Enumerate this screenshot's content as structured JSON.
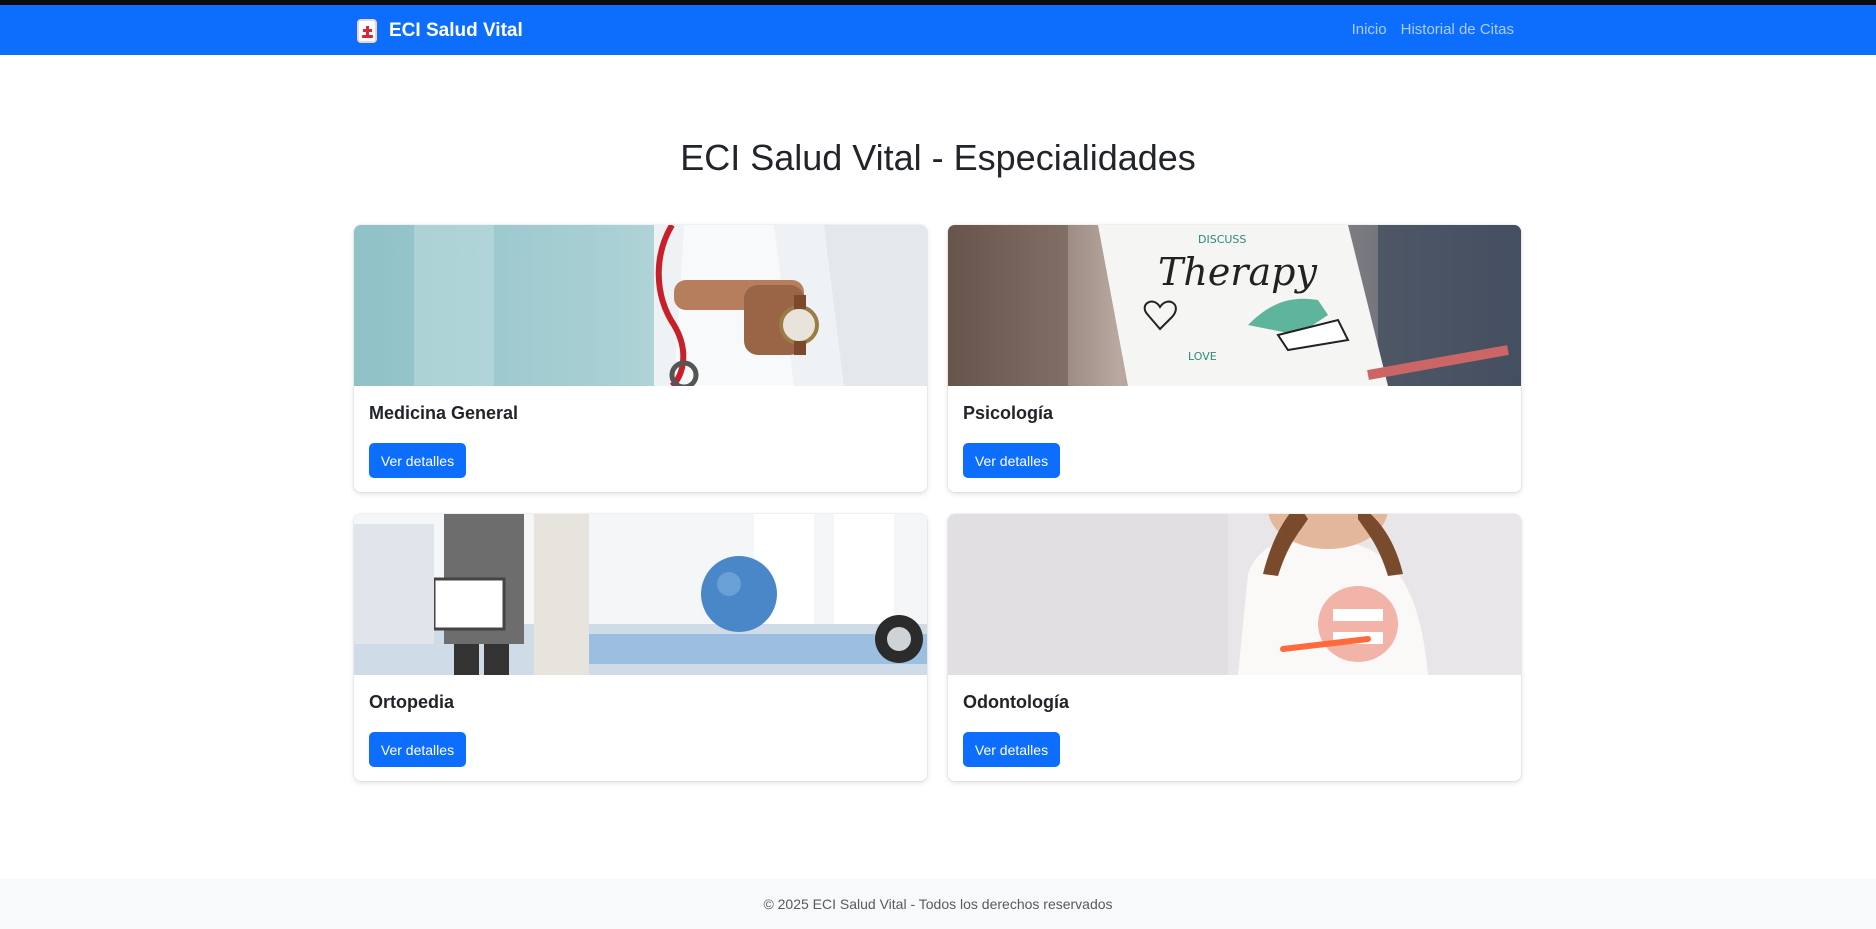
{
  "navbar": {
    "brand": "ECI Salud Vital",
    "links": [
      "Inicio",
      "Historial de Citas"
    ],
    "accent_color": "#0d6efd",
    "logo_icon": "medical-cross-icon"
  },
  "main": {
    "title": "ECI Salud Vital - Especialidades",
    "cards": [
      {
        "title": "Medicina General",
        "button": "Ver detalles",
        "image_icon": "doctor-photo"
      },
      {
        "title": "Psicología",
        "button": "Ver detalles",
        "image_icon": "therapy-photo"
      },
      {
        "title": "Ortopedia",
        "button": "Ver detalles",
        "image_icon": "physiotherapy-photo"
      },
      {
        "title": "Odontología",
        "button": "Ver detalles",
        "image_icon": "dental-photo"
      }
    ]
  },
  "footer": {
    "text": "© 2025 ECI Salud Vital - Todos los derechos reservados"
  }
}
